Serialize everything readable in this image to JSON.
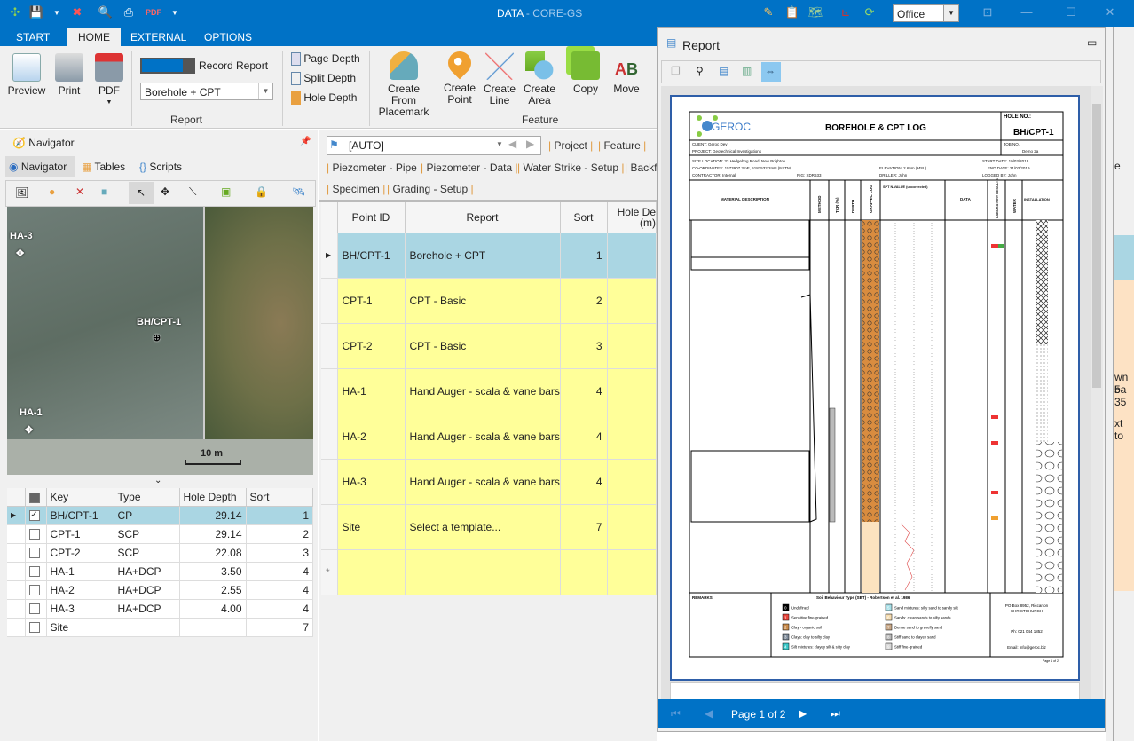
{
  "app": {
    "title": "DATA",
    "subtitle": " - CORE-GS",
    "theme_select": "Office"
  },
  "colors": {
    "accent": "#0072c6",
    "selected_row": "#aad6e3",
    "template_row": "#ffff99",
    "right_row": "#fde2c4"
  },
  "ribbon": {
    "tabs": [
      "START",
      "HOME",
      "EXTERNAL",
      "OPTIONS"
    ],
    "report": {
      "preview": "Preview",
      "print": "Print",
      "pdf": "PDF",
      "record_report": "Record Report",
      "template_select": "Borehole + CPT",
      "group": "Report"
    },
    "depth": {
      "page_depth": "Page Depth",
      "split_depth": "Split Depth",
      "hole_depth": "Hole Depth"
    },
    "feature": {
      "create_from_placemark": "Create From Placemark",
      "create_point": "Create Point",
      "create_line": "Create Line",
      "create_area": "Create Area",
      "copy": "Copy",
      "move": "Move",
      "group": "Feature"
    }
  },
  "navigator": {
    "title": "Navigator",
    "tabs": [
      "Navigator",
      "Tables",
      "Scripts"
    ],
    "map_labels": {
      "ha3": "HA-3",
      "bh": "BH/CPT-1",
      "ha1": "HA-1",
      "scale": "10 m"
    },
    "table": {
      "headers": [
        "Key",
        "Type",
        "Hole Depth",
        "Sort"
      ],
      "rows": [
        {
          "key": "BH/CPT-1",
          "type": "CP",
          "depth": "29.14",
          "sort": "1",
          "checked": true
        },
        {
          "key": "CPT-1",
          "type": "SCP",
          "depth": "29.14",
          "sort": "2"
        },
        {
          "key": "CPT-2",
          "type": "SCP",
          "depth": "22.08",
          "sort": "3"
        },
        {
          "key": "HA-1",
          "type": "HA+DCP",
          "depth": "3.50",
          "sort": "4"
        },
        {
          "key": "HA-2",
          "type": "HA+DCP",
          "depth": "2.55",
          "sort": "4"
        },
        {
          "key": "HA-3",
          "type": "HA+DCP",
          "depth": "4.00",
          "sort": "4"
        },
        {
          "key": "Site",
          "type": "",
          "depth": "",
          "sort": "7"
        }
      ]
    }
  },
  "data_panel": {
    "table_select": "[AUTO]",
    "links": [
      "Project",
      "Feature",
      "Piezometer - Pipe",
      "Piezometer - Data",
      "Water Strike - Setup",
      "Backfi",
      "Specimen",
      "Grading - Setup"
    ],
    "headers": [
      "Point ID",
      "Report",
      "Sort",
      "Hole De (m)"
    ],
    "rows": [
      {
        "id": "BH/CPT-1",
        "report": "Borehole + CPT",
        "sort": "1"
      },
      {
        "id": "CPT-1",
        "report": "CPT - Basic",
        "sort": "2"
      },
      {
        "id": "CPT-2",
        "report": "CPT - Basic",
        "sort": "3"
      },
      {
        "id": "HA-1",
        "report": "Hand Auger - scala & vane bars",
        "sort": "4"
      },
      {
        "id": "HA-2",
        "report": "Hand Auger - scala & vane bars",
        "sort": "4"
      },
      {
        "id": "HA-3",
        "report": "Hand Auger - scala & vane bars",
        "sort": "4"
      },
      {
        "id": "Site",
        "report": "Select a template...",
        "sort": "7"
      }
    ],
    "new_row_marker": "*"
  },
  "report_window": {
    "title": "Report",
    "pager": "Page 1 of 2",
    "doc": {
      "logo": "GEROC",
      "heading": "BOREHOLE & CPT LOG",
      "hole_no_label": "HOLE NO.:",
      "hole_no": "BH/CPT-1",
      "client": "CLIENT:  Geroc Dev",
      "project": "PROJECT: Geotechnical Investigations",
      "job_no_label": "JOB NO.:",
      "job_no": "Demo 2a",
      "site_location": "SITE LOCATION:  33 Hedgehog Road, New Brighton",
      "coordinates": "CO-ORDINATES:  1573907.3mE, 5181532.2mN (NZTM)",
      "contractor": "CONTRACTOR:  Internal",
      "rig": "RIG:  XDR633",
      "elevation": "ELEVATION:  2.65m (MSL)",
      "driller": "DRILLER:  John",
      "start_date": "START DATE: 19/03/2019",
      "end_date": "END DATE: 21/03/2019",
      "logged_by": "LOGGED BY: John",
      "columns": [
        "MATERIAL DESCRIPTION",
        "METHOD",
        "TCR (%)",
        "DEPTH",
        "GRAPHIC LOG",
        "SPT N-VALUE (uncorrected)",
        "DATA",
        "LABORATORY RESULTS",
        "WATER",
        "INSTALLATION"
      ],
      "remarks": "REMARKS",
      "legend_title": "Soil Behaviour Type (SBT) - Robertson et al. 1986",
      "legend": [
        {
          "code": "0",
          "label": "Undefined",
          "color": "#000000"
        },
        {
          "code": "1",
          "label": "Sensitive fine-grained",
          "color": "#e8453c"
        },
        {
          "code": "2",
          "label": "Clay - organic soil",
          "color": "#c98a4a"
        },
        {
          "code": "3",
          "label": "Clays: clay to silty clay",
          "color": "#7d8a99"
        },
        {
          "code": "4",
          "label": "Silt mixtures: clayey silt & silty clay",
          "color": "#3cc8c8"
        },
        {
          "code": "5",
          "label": "Sand mixtures: silty sand to sandy silt",
          "color": "#a8e0e8"
        },
        {
          "code": "6",
          "label": "Sands: clean sands to silty sands",
          "color": "#f5dcb0"
        },
        {
          "code": "7",
          "label": "Dense sand to gravelly sand",
          "color": "#c8a888"
        },
        {
          "code": "8",
          "label": "Stiff sand to clayey sand",
          "color": "#b8b8b8"
        },
        {
          "code": "9",
          "label": "Stiff fine-grained",
          "color": "#d8d8d8"
        }
      ],
      "address1": "PO Box 8952, Riccarton",
      "address2": "CHRISTCHURCH",
      "phone": "Ph: 021 044 1852",
      "email": "Email: info@geroc.biz",
      "page_footer": "Page 1 of 2"
    }
  },
  "right_edge": {
    "link_fragment": "e",
    "row_text_1": "wn ba",
    "row_text_2": "5-35",
    "row_text_3": "xt to"
  }
}
